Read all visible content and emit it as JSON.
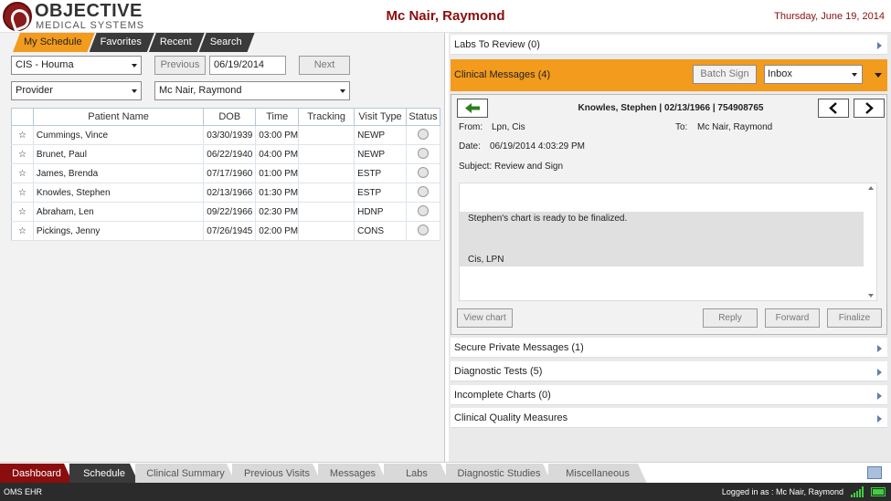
{
  "header": {
    "logo_line1": "OBJECTIVE",
    "logo_line2": "MEDICAL SYSTEMS",
    "patient": "Mc Nair, Raymond",
    "date": "Thursday, June 19, 2014"
  },
  "subtabs": [
    "My Schedule",
    "Favorites",
    "Recent",
    "Search"
  ],
  "schedule": {
    "location": "CIS - Houma",
    "prev_label": "Previous",
    "date_value": "06/19/2014",
    "next_label": "Next",
    "filter_type": "Provider",
    "provider": "Mc Nair, Raymond",
    "columns": [
      "Patient Name",
      "DOB",
      "Time",
      "Tracking",
      "Visit Type",
      "Status"
    ],
    "rows": [
      {
        "name": "Cummings, Vince",
        "dob": "03/30/1939",
        "time": "03:00 PM",
        "tracking": "",
        "visit": "NEWP"
      },
      {
        "name": "Brunet, Paul",
        "dob": "06/22/1940",
        "time": "04:00 PM",
        "tracking": "",
        "visit": "NEWP"
      },
      {
        "name": "James, Brenda",
        "dob": "07/17/1960",
        "time": "01:00 PM",
        "tracking": "",
        "visit": "ESTP"
      },
      {
        "name": "Knowles, Stephen",
        "dob": "02/13/1966",
        "time": "01:30 PM",
        "tracking": "",
        "visit": "ESTP"
      },
      {
        "name": "Abraham, Len",
        "dob": "09/22/1966",
        "time": "02:30 PM",
        "tracking": "",
        "visit": "HDNP"
      },
      {
        "name": "Pickings, Jenny",
        "dob": "07/26/1945",
        "time": "02:00 PM",
        "tracking": "",
        "visit": "CONS"
      }
    ]
  },
  "right": {
    "labs": "Labs To Review (0)",
    "clinical_messages": "Clinical Messages (4)",
    "batch_sign": "Batch Sign",
    "inbox": "Inbox",
    "message": {
      "header": "Knowles, Stephen | 02/13/1966 | 754908765",
      "from_label": "From:",
      "from": "Lpn, Cis",
      "to_label": "To:",
      "to": "Mc Nair, Raymond",
      "date_label": "Date:",
      "date": "06/19/2014 4:03:29 PM",
      "subject_label": "Subject:",
      "subject": "Review and Sign",
      "body_line1": "Stephen's chart is ready to be finalized.",
      "body_line2": "Cis, LPN",
      "view_chart": "View chart",
      "reply": "Reply",
      "forward": "Forward",
      "finalize": "Finalize"
    },
    "secure": "Secure Private Messages (1)",
    "diagnostic": "Diagnostic Tests (5)",
    "incomplete": "Incomplete Charts (0)",
    "quality": "Clinical Quality Measures"
  },
  "bottom_tabs": [
    "Dashboard",
    "Schedule",
    "Clinical Summary",
    "Previous Visits",
    "Messages",
    "Labs",
    "Diagnostic Studies",
    "Miscellaneous"
  ],
  "status": {
    "app": "OMS EHR",
    "logged": "Logged in as : Mc Nair, Raymond"
  }
}
